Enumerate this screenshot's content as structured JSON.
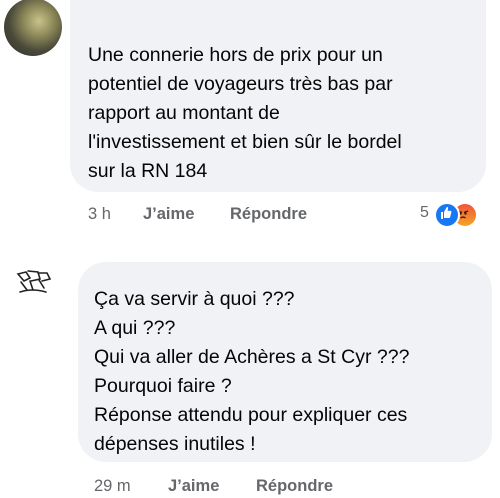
{
  "comments": [
    {
      "text": "Une connerie hors de prix pour un\npotentiel de voyageurs très bas par\nrapport au montant de\nl'investissement et bien sûr le bordel\nsur la RN 184",
      "time": "3 h",
      "like_label": "J’aime",
      "reply_label": "Répondre",
      "reaction_count": "5",
      "reactions": [
        "like-icon",
        "angry-icon"
      ]
    },
    {
      "text": "Ça va servir à quoi ???\nA qui ???\nQui va aller de Achères a St Cyr ???\nPourquoi faire ?\nRéponse attendu pour expliquer ces\ndépenses inutiles !",
      "time": "29 m",
      "like_label": "J’aime",
      "reply_label": "Répondre"
    }
  ],
  "colors": {
    "bubble": "#f0f2f5",
    "meta_text": "#65676b",
    "like_blue": "#1877f2",
    "angry_orange": "#f0533a"
  }
}
